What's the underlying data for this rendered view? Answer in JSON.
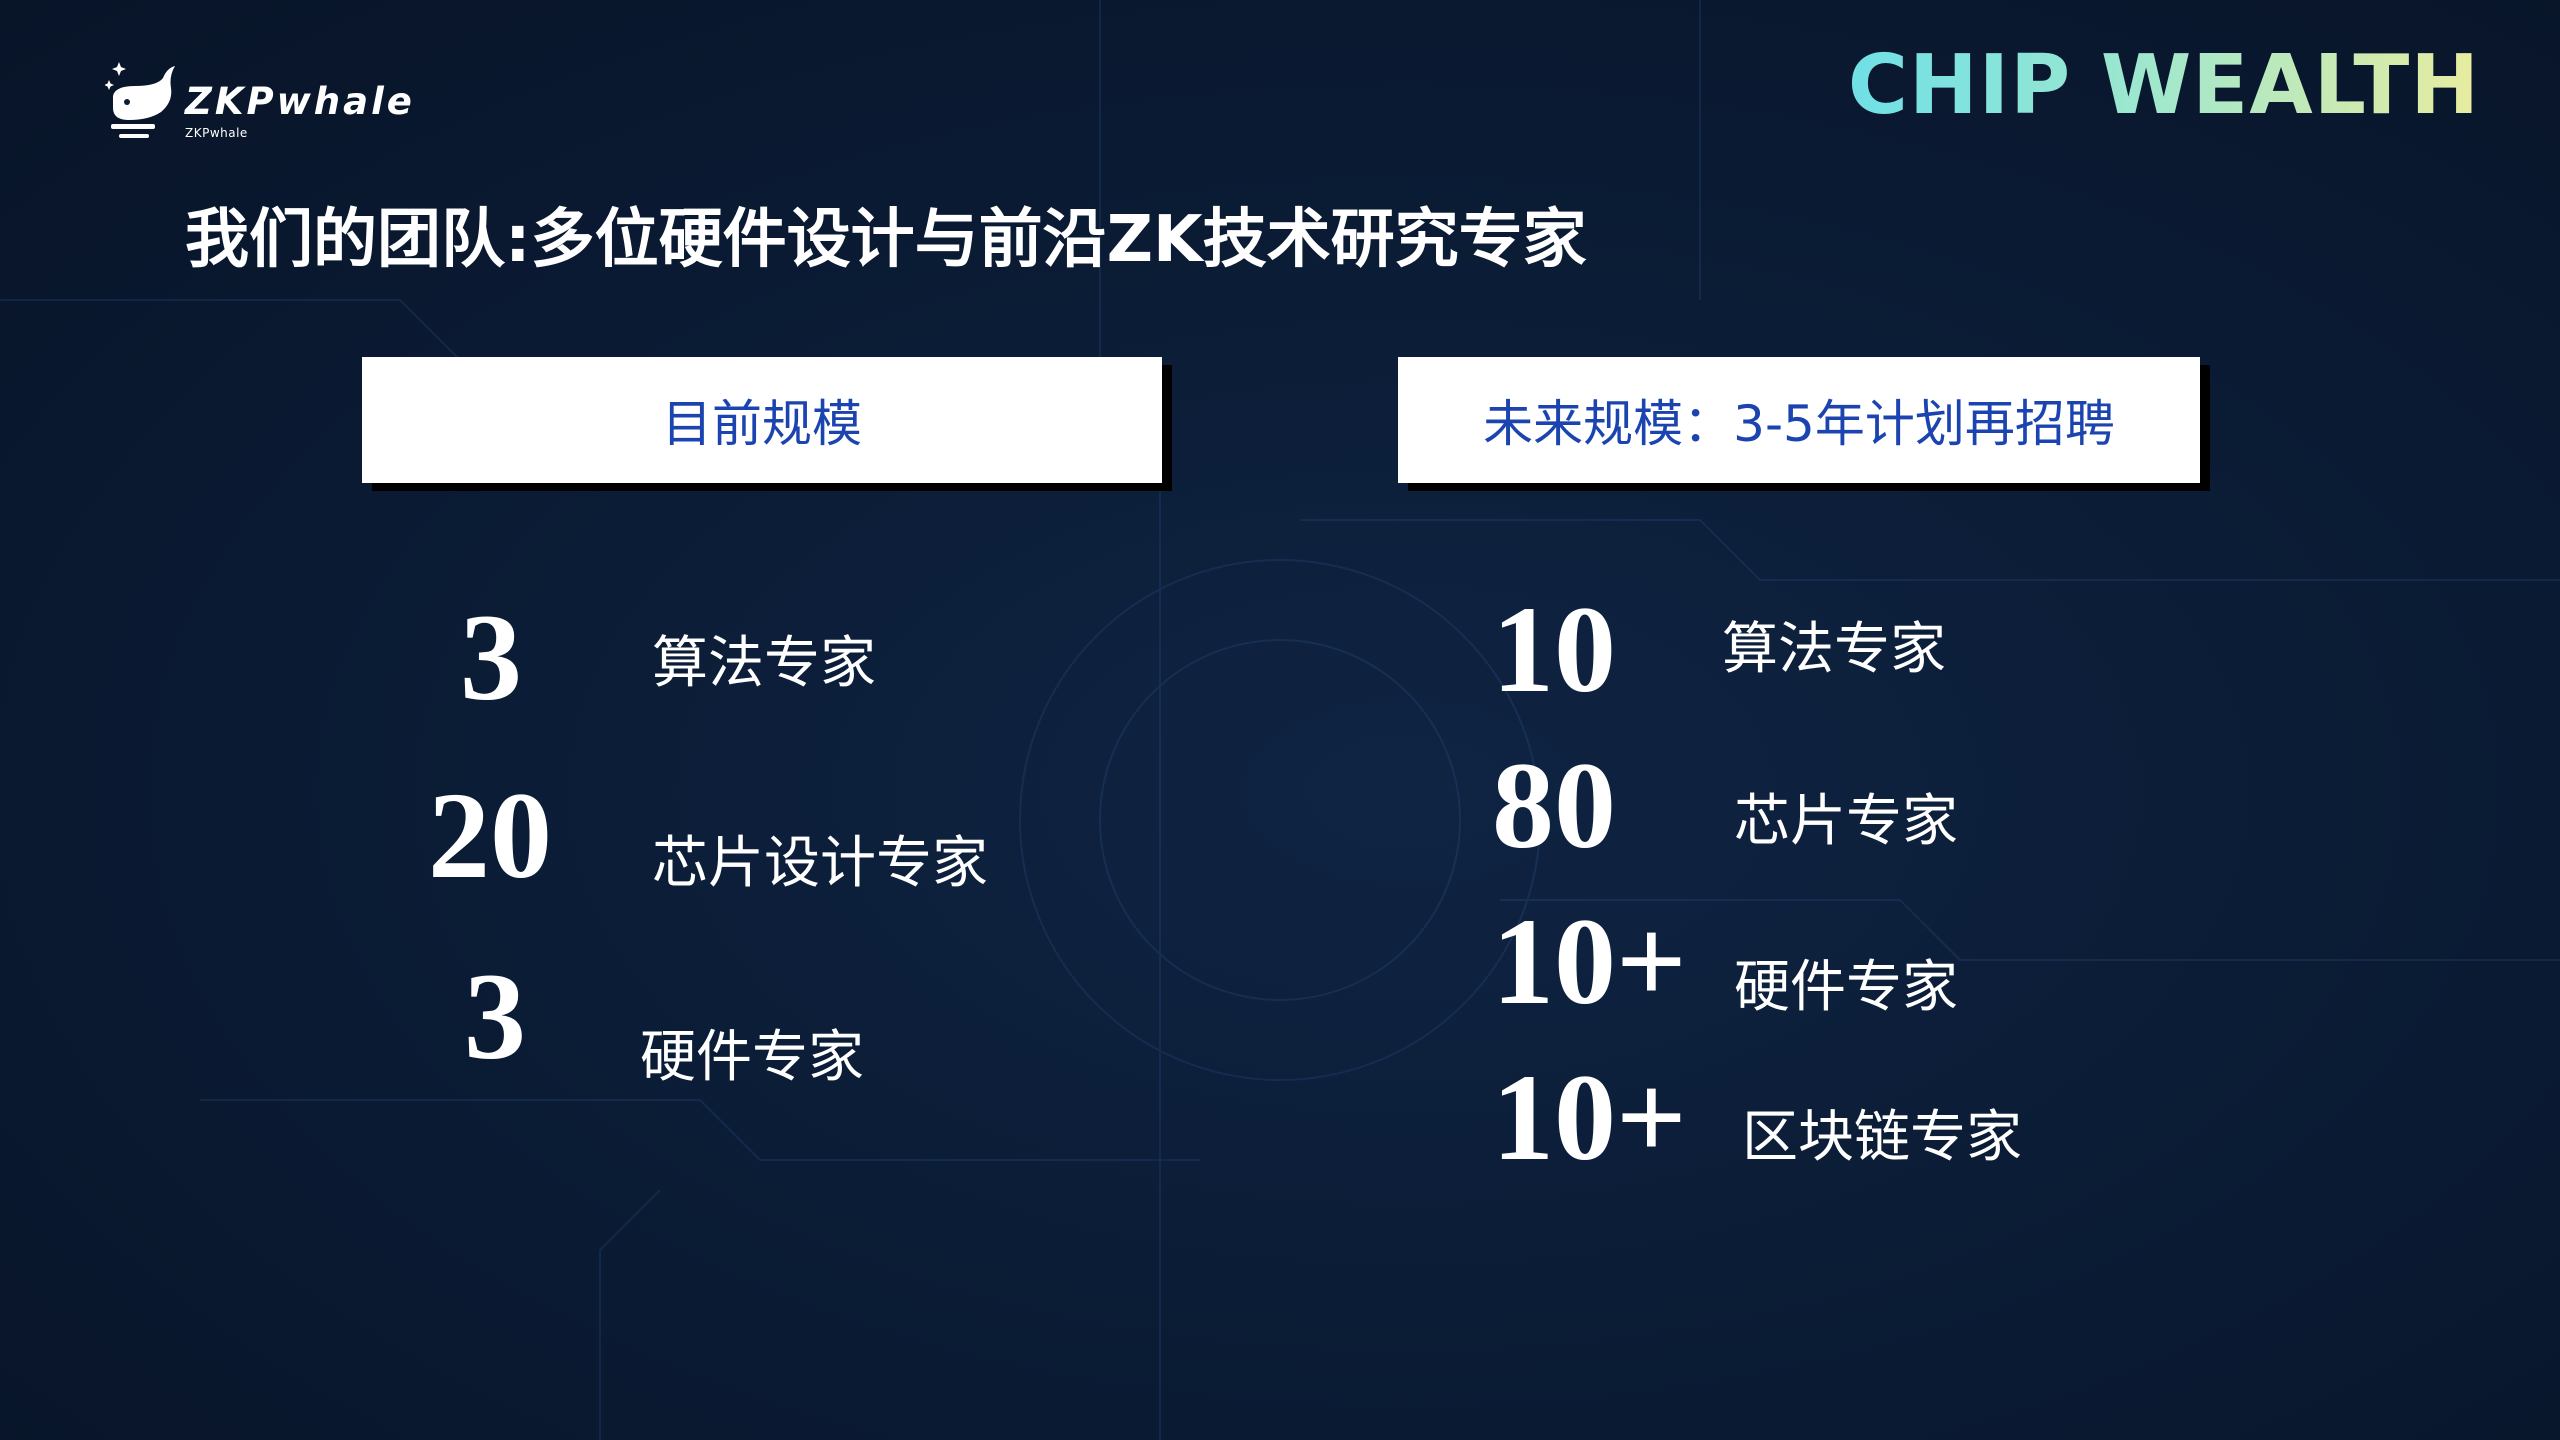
{
  "logo": {
    "text": "ZKPwhale",
    "subtext": "ZKPwhale"
  },
  "brand": "CHIP WEALTH",
  "title": "我们的团队:多位硬件设计与前沿ZK技术研究专家",
  "current": {
    "heading": "目前规模",
    "rows": [
      {
        "value": "3",
        "label": "算法专家"
      },
      {
        "value": "20",
        "label": "芯片设计专家"
      },
      {
        "value": "3",
        "label": "硬件专家"
      }
    ]
  },
  "future": {
    "heading": "未来规模：3-5年计划再招聘",
    "rows": [
      {
        "value": "10",
        "label": "算法专家"
      },
      {
        "value": "80",
        "label": "芯片专家"
      },
      {
        "value": "10+",
        "label": "硬件专家"
      },
      {
        "value": "10+",
        "label": "区块链专家"
      }
    ]
  }
}
